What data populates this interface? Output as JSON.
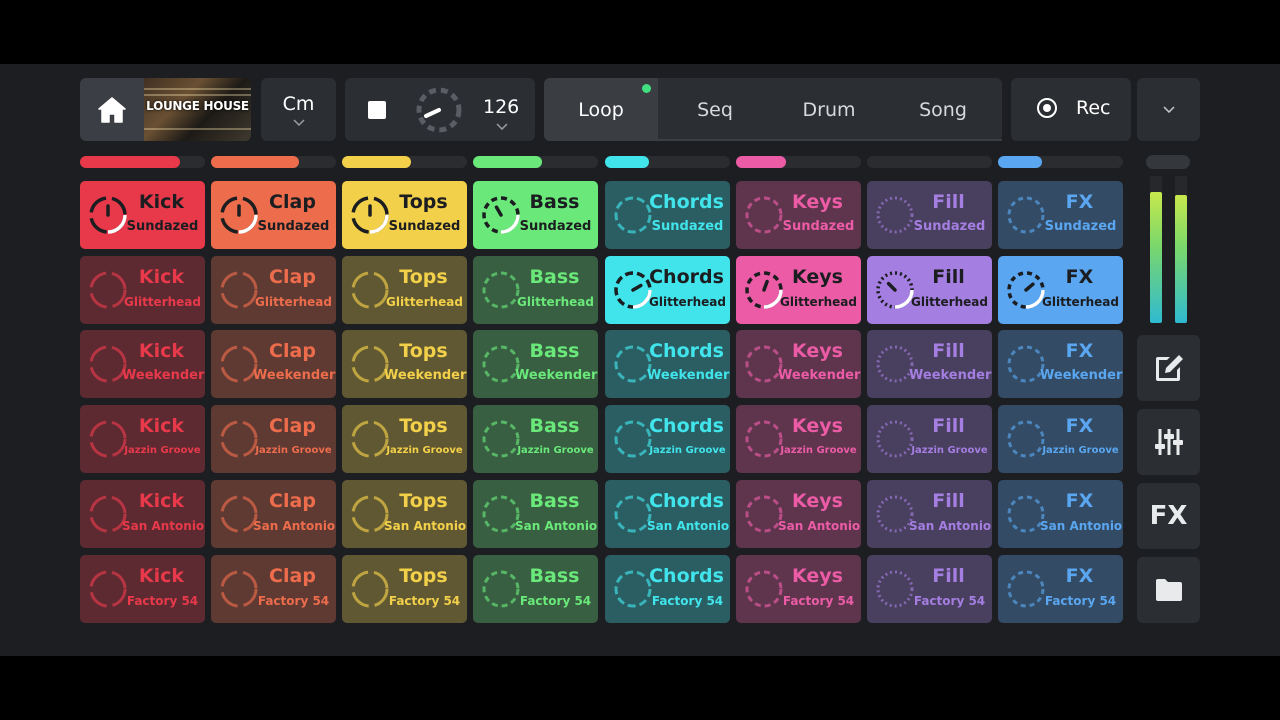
{
  "header": {
    "cover_text": "LOUNGE HOUSE",
    "key": "Cm",
    "tempo": "126",
    "modes": [
      "Loop",
      "Seq",
      "Drum",
      "Song"
    ],
    "active_mode": "Loop",
    "record_label": "Rec"
  },
  "tracks": [
    {
      "name": "Kick",
      "color": "#e8394a",
      "level": 0.8
    },
    {
      "name": "Clap",
      "color": "#ec6c4c",
      "level": 0.7
    },
    {
      "name": "Tops",
      "color": "#f2d04a",
      "level": 0.55
    },
    {
      "name": "Bass",
      "color": "#6ae87a",
      "level": 0.55
    },
    {
      "name": "Chords",
      "color": "#40e4ea",
      "level": 0.35
    },
    {
      "name": "Keys",
      "color": "#ec5ca6",
      "level": 0.4
    },
    {
      "name": "Fill",
      "color": "#a47ee0",
      "level": 0.0
    },
    {
      "name": "FX",
      "color": "#5aa6f0",
      "level": 0.35
    }
  ],
  "kits": [
    "Sundazed",
    "Glitterhead",
    "Weekender",
    "Jazzin Groove",
    "San Antonio",
    "Factory 54"
  ],
  "active_pads": [
    [
      0,
      0
    ],
    [
      1,
      0
    ],
    [
      2,
      0
    ],
    [
      3,
      0
    ],
    [
      4,
      1
    ],
    [
      5,
      1
    ],
    [
      6,
      1
    ],
    [
      7,
      1
    ]
  ],
  "master_levels": {
    "left": 0.89,
    "right": 0.87
  },
  "side_buttons": {
    "fx_label": "FX"
  }
}
